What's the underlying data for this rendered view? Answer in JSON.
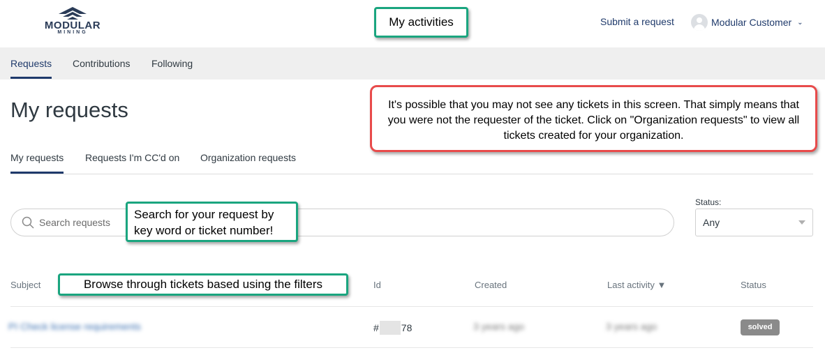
{
  "header": {
    "logo_text": "MODULAR",
    "logo_subtext": "MINING",
    "submit_request": "Submit a request",
    "user_name": "Modular Customer",
    "chevron": "⌄"
  },
  "activity_nav": {
    "tabs": [
      {
        "label": "Requests",
        "active": true
      },
      {
        "label": "Contributions",
        "active": false
      },
      {
        "label": "Following",
        "active": false
      }
    ]
  },
  "page": {
    "title": "My requests"
  },
  "sub_tabs": [
    {
      "label": "My requests",
      "active": true
    },
    {
      "label": "Requests I'm CC'd on",
      "active": false
    },
    {
      "label": "Organization requests",
      "active": false
    }
  ],
  "search": {
    "placeholder": "Search requests",
    "icon": "search-icon"
  },
  "status_filter": {
    "label": "Status:",
    "selected": "Any"
  },
  "table": {
    "columns": [
      "Subject",
      "Id",
      "Created",
      "Last activity ▼",
      "Status"
    ],
    "rows": [
      {
        "subject": "PI Check license requirements",
        "id_prefix": "#",
        "id_suffix": "78",
        "created": "3 years ago",
        "last_activity": "3 years ago",
        "status": "solved"
      }
    ]
  },
  "annotations": {
    "my_activities": "My activities",
    "search_tip": "Search for your request by key word or ticket number!",
    "browse_tip": "Browse through tickets based using the filters",
    "notice": "It's possible that you may not see any tickets in this screen. That simply means that you were not the requester of the ticket. Click on \"Organization requests\" to view all tickets created for your organization."
  },
  "colors": {
    "brand": "#1f3a6b",
    "callout_green": "#1aa57f",
    "callout_red": "#e84b4b",
    "badge_solved": "#8a8a8a"
  }
}
